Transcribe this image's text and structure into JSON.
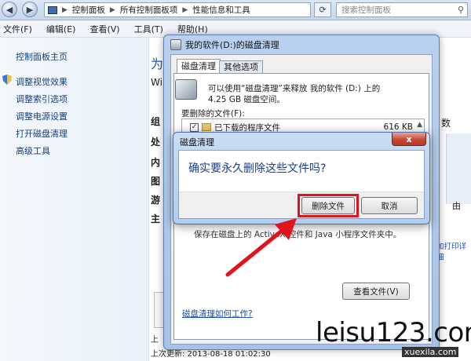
{
  "address_bar": {
    "crumbs": [
      "控制面板",
      "所有控制面板项",
      "性能信息和工具"
    ],
    "search_placeholder": "搜索控制面板"
  },
  "menu": [
    "文件(F)",
    "编辑(E)",
    "查看(V)",
    "工具(T)",
    "帮助(H)"
  ],
  "sidebar": {
    "items": [
      {
        "label": "控制面板主页"
      },
      {
        "label": "调整视觉效果"
      },
      {
        "label": "调整索引选项"
      },
      {
        "label": "调整电源设置"
      },
      {
        "label": "打开磁盘清理"
      },
      {
        "label": "高级工具"
      }
    ]
  },
  "background": {
    "frag_title": "为",
    "frag_wi": "Wi",
    "frag_group": "组",
    "frag_rows": [
      "处",
      "内",
      "图",
      "游",
      "主"
    ],
    "right_text_1": "数",
    "right_text_2": "由",
    "right_text_3": "加打印详细",
    "bottom_line_1": "上",
    "bottom_line_2": "上次更新: 2013-08-18 01:02:30"
  },
  "disk_cleanup": {
    "title": "我的软件(D:)的磁盘清理",
    "tabs": [
      "磁盘清理",
      "其他选项"
    ],
    "desc_line_1": "可以使用“磁盘清理”来释放 我的软件 (D:) 上的",
    "desc_line_2": "4.25 GB 磁盘空间。",
    "list_label": "要删除的文件(F):",
    "files": [
      {
        "name": "已下载的程序文件",
        "size": "616 KB",
        "checked": true
      }
    ],
    "check_mark": "✓",
    "lower_text": "保存在磁盘上的 ActiveX 控件和 Java 小程序文件夹中。",
    "view_files_button": "查看文件(V)",
    "how_link": "磁盘清理如何工作?"
  },
  "confirm_dialog": {
    "title": "磁盘清理",
    "close_glyph": "x",
    "question": "确实要永久删除这些文件吗?",
    "delete_button": "删除文件",
    "cancel_button": "取消"
  },
  "watermark": {
    "text": "leisu123.com",
    "sub": "xuexila.com"
  },
  "colors": {
    "highlight": "#e0141e",
    "arrow": "#e0141e",
    "link": "#1d4fa5"
  }
}
